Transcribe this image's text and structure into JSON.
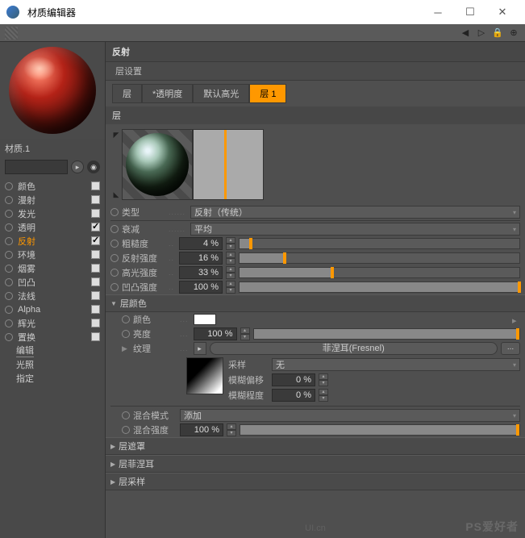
{
  "window": {
    "title": "材质编辑器"
  },
  "material": {
    "name": "材质.1"
  },
  "channels": [
    {
      "label": "颜色",
      "checked": false,
      "active": false
    },
    {
      "label": "漫射",
      "checked": false,
      "active": false
    },
    {
      "label": "发光",
      "checked": false,
      "active": false
    },
    {
      "label": "透明",
      "checked": true,
      "active": false
    },
    {
      "label": "反射",
      "checked": true,
      "active": true
    },
    {
      "label": "环境",
      "checked": false,
      "active": false
    },
    {
      "label": "烟雾",
      "checked": false,
      "active": false
    },
    {
      "label": "凹凸",
      "checked": false,
      "active": false
    },
    {
      "label": "法线",
      "checked": false,
      "active": false
    },
    {
      "label": "Alpha",
      "checked": false,
      "active": false
    },
    {
      "label": "辉光",
      "checked": false,
      "active": false
    },
    {
      "label": "置换",
      "checked": false,
      "active": false
    }
  ],
  "sub_items": [
    "编辑",
    "光照",
    "指定"
  ],
  "reflection": {
    "header": "反射",
    "layer_settings": "层设置",
    "tabs": [
      "层",
      "*透明度",
      "默认高光",
      "层 1"
    ],
    "layer_label": "层",
    "type": {
      "label": "类型",
      "value": "反射（传统）"
    },
    "atten": {
      "label": "衰减",
      "value": "平均"
    },
    "rough": {
      "label": "粗糙度",
      "value": "4 %",
      "pct": 4
    },
    "refl_str": {
      "label": "反射强度",
      "value": "16 %",
      "pct": 16
    },
    "spec_str": {
      "label": "高光强度",
      "value": "33 %",
      "pct": 33
    },
    "bump_str": {
      "label": "凹凸强度",
      "value": "100 %",
      "pct": 100
    }
  },
  "layer_color": {
    "header": "层颜色",
    "color": {
      "label": "颜色"
    },
    "brightness": {
      "label": "亮度",
      "value": "100 %",
      "pct": 100
    },
    "texture": {
      "label": "纹理",
      "value": "菲涅耳(Fresnel)"
    },
    "sample": {
      "label": "采样",
      "value": "无"
    },
    "blur_off": {
      "label": "模糊偏移",
      "value": "0 %",
      "pct": 0
    },
    "blur_scale": {
      "label": "模糊程度",
      "value": "0 %",
      "pct": 0
    }
  },
  "blend": {
    "mode": {
      "label": "混合模式",
      "value": "添加"
    },
    "strength": {
      "label": "混合强度",
      "value": "100 %",
      "pct": 100
    }
  },
  "collapsed": [
    "层遮罩",
    "层菲涅耳",
    "层采样"
  ],
  "watermarks": {
    "a": "PS爱好者",
    "b": "UI.cn"
  }
}
